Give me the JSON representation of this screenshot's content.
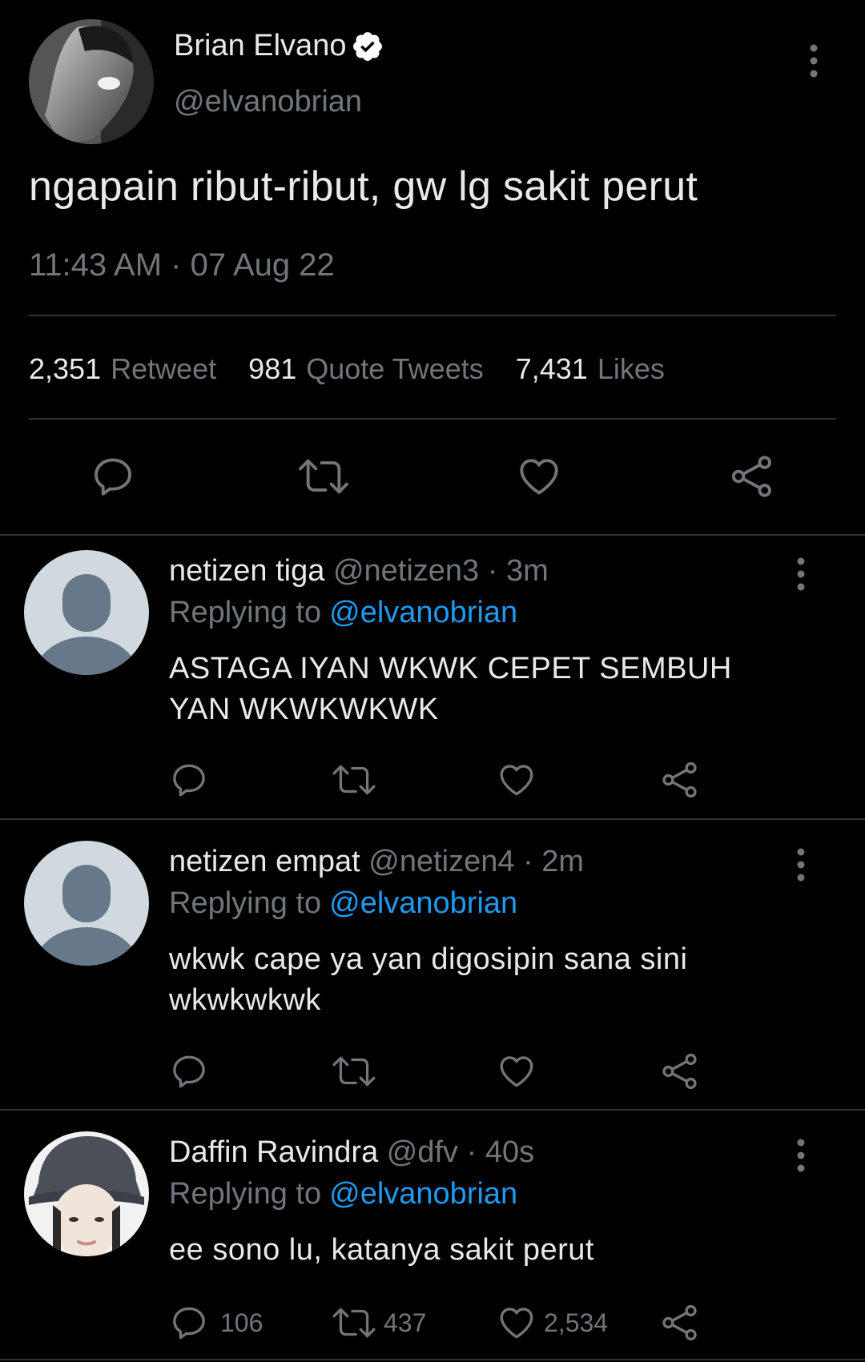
{
  "tweet": {
    "author_name": "Brian Elvano",
    "author_handle": "@elvanobrian",
    "text": "ngapain ribut-ribut, gw lg sakit perut",
    "timestamp": "11:43 AM · 07 Aug 22",
    "stats": [
      {
        "count": "2,351",
        "label": "Retweet"
      },
      {
        "count": "981",
        "label": "Quote Tweets"
      },
      {
        "count": "7,431",
        "label": "Likes"
      }
    ]
  },
  "replies": [
    {
      "name": "netizen tiga",
      "meta": "@netizen3 · 3m",
      "replying_label": "Replying to",
      "replying_to": "@elvanobrian",
      "text": "ASTAGA IYAN WKWK CEPET SEMBUH YAN WKWKWKWK",
      "counts": {
        "reply": "",
        "retweet": "",
        "like": ""
      }
    },
    {
      "name": "netizen empat",
      "meta": "@netizen4 · 2m",
      "replying_label": "Replying to",
      "replying_to": "@elvanobrian",
      "text": "wkwk cape ya yan digosipin sana sini wkwkwkwk",
      "counts": {
        "reply": "",
        "retweet": "",
        "like": ""
      }
    },
    {
      "name": "Daffin Ravindra",
      "meta": "@dfv · 40s",
      "replying_label": "Replying to",
      "replying_to": "@elvanobrian",
      "text": "ee sono lu, katanya sakit perut",
      "counts": {
        "reply": "106",
        "retweet": "437",
        "like": "2,534"
      }
    }
  ],
  "colors": {
    "background": "#000000",
    "text_primary": "#e7e9ea",
    "text_secondary": "#71767b",
    "link": "#1d9bf0",
    "divider": "#2f3336"
  }
}
